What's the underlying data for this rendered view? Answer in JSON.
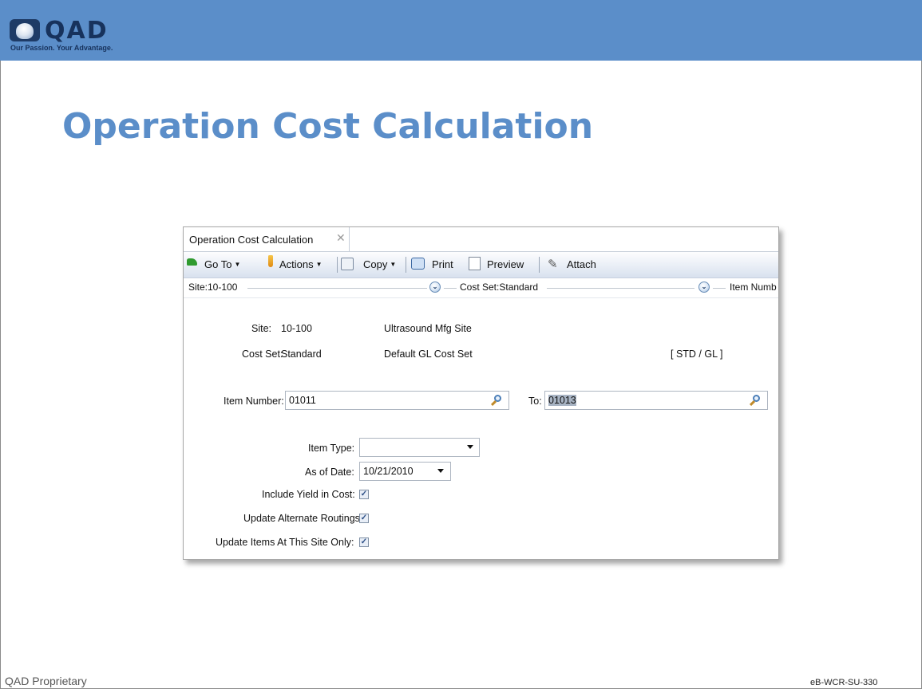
{
  "slide": {
    "logo_text": "QAD",
    "tagline": "Our Passion. Your Advantage.",
    "title": "Operation Cost Calculation",
    "footer_left": "QAD Proprietary",
    "footer_right": "eB-WCR-SU-330",
    "banner_color": "#5b8ec9"
  },
  "app": {
    "tab_label": "Operation Cost Calculation",
    "toolbar": {
      "goto": "Go To",
      "actions": "Actions",
      "copy": "Copy",
      "print": "Print",
      "preview": "Preview",
      "attach": "Attach"
    },
    "breadcrumb": {
      "site": "Site:10-100",
      "cost_set": "Cost Set:Standard",
      "item_number": "Item Numb"
    },
    "info": {
      "site_label": "Site:",
      "site_value": "10-100",
      "site_desc": "Ultrasound Mfg Site",
      "cost_set_label": "Cost Set:",
      "cost_set_value": "Standard",
      "cost_set_desc": "Default GL Cost Set",
      "cost_set_code": "[ STD / GL ]"
    },
    "form": {
      "item_number_label": "Item Number:",
      "item_number_value": "01011",
      "to_label": "To:",
      "to_value": "01013",
      "item_type_label": "Item Type:",
      "item_type_value": "",
      "as_of_date_label": "As of Date:",
      "as_of_date_value": "10/21/2010",
      "include_yield_label": "Include Yield in Cost:",
      "update_alt_label": "Update Alternate Routings:",
      "update_items_label": "Update Items At This Site Only:",
      "include_yield_checked": true,
      "update_alt_checked": true,
      "update_items_checked": true
    }
  }
}
